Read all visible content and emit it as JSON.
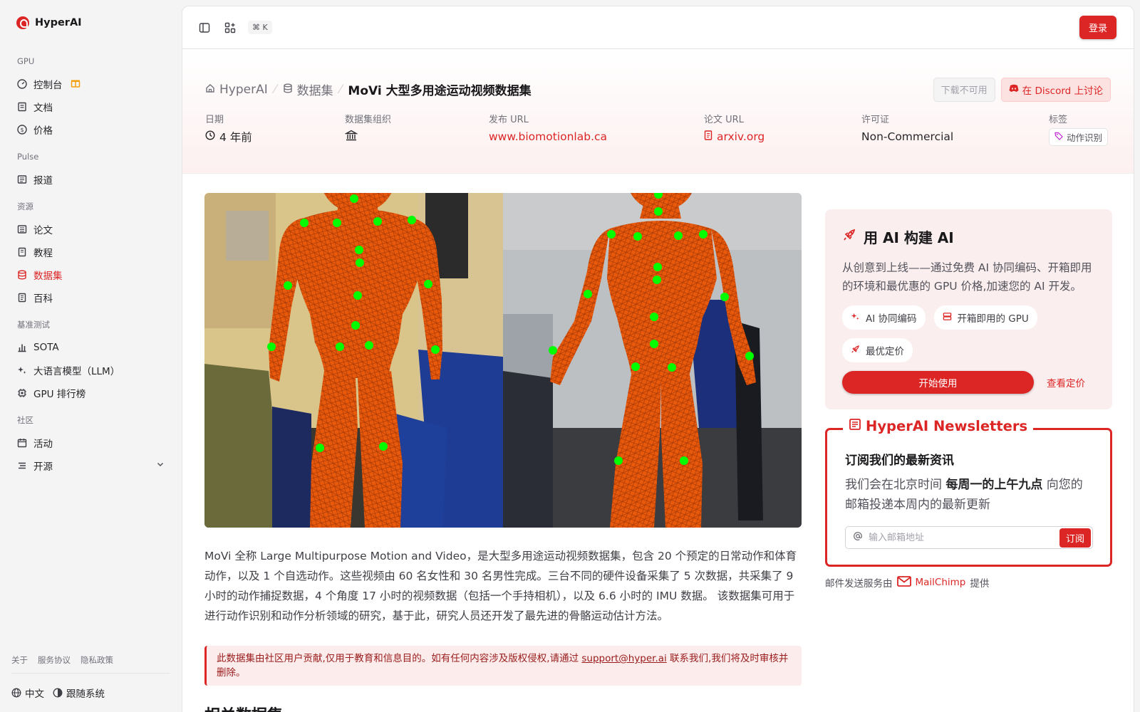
{
  "brand": {
    "name": "HyperAI"
  },
  "sidebar": {
    "sections": [
      {
        "title": "GPU",
        "items": [
          {
            "label": "控制台",
            "icon": "dashboard-icon"
          },
          {
            "label": "文档",
            "icon": "book-icon"
          },
          {
            "label": "价格",
            "icon": "dollar-icon"
          }
        ]
      },
      {
        "title": "Pulse",
        "items": [
          {
            "label": "报道",
            "icon": "newspaper-icon"
          }
        ]
      },
      {
        "title": "资源",
        "items": [
          {
            "label": "论文",
            "icon": "paper-icon"
          },
          {
            "label": "教程",
            "icon": "tutorial-icon"
          },
          {
            "label": "数据集",
            "icon": "database-icon",
            "active": true
          },
          {
            "label": "百科",
            "icon": "encyclopedia-icon"
          }
        ]
      },
      {
        "title": "基准测试",
        "items": [
          {
            "label": "SOTA",
            "icon": "bar-chart-icon"
          },
          {
            "label": "大语言模型（LLM）",
            "icon": "sparkle-icon"
          },
          {
            "label": "GPU 排行榜",
            "icon": "chip-icon"
          }
        ]
      },
      {
        "title": "社区",
        "items": [
          {
            "label": "活动",
            "icon": "calendar-icon"
          },
          {
            "label": "开源",
            "icon": "list-icon"
          }
        ]
      }
    ],
    "footer_links": [
      "关于",
      "服务协议",
      "隐私政策"
    ],
    "language": "中文",
    "theme": "跟随系统"
  },
  "topbar": {
    "shortcut": "⌘ K",
    "login": "登录"
  },
  "hero": {
    "breadcrumb": {
      "home": "HyperAI",
      "section": "数据集",
      "current": "MoVi 大型多用途运动视频数据集"
    },
    "download_label": "下载不可用",
    "discord_label": "在 Discord 上讨论",
    "meta": {
      "date_label": "日期",
      "date_value": "4 年前",
      "org_label": "数据集组织",
      "url_label": "发布 URL",
      "url_value": "www.biomotionlab.ca",
      "paper_label": "论文 URL",
      "paper_value": "arxiv.org",
      "license_label": "许可证",
      "license_value": "Non-Commercial",
      "tags_label": "标签",
      "tag_value": "动作识别"
    }
  },
  "content": {
    "description": "MoVi 全称 Large Multipurpose Motion and Video，是大型多用途运动视频数据集，包含 20 个预定的日常动作和体育动作，以及 1 个自选动作。这些视频由 60 名女性和 30 名男性完成。三台不同的硬件设备采集了 5 次数据，共采集了 9 小时的动作捕捉数据，4 个角度 17 小时的视频数据（包括一个手持相机），以及 6.6 小时的 IMU 数据。 该数据集可用于进行动作识别和动作分析领域的研究，基于此，研究人员还开发了最先进的骨骼运动估计方法。",
    "notice_prefix": "此数据集由社区用户贡献,仅用于教育和信息目的。如有任何内容涉及版权侵权,请通过 ",
    "notice_email": "support@hyper.ai",
    "notice_suffix": " 联系我们,我们将及时审核并删除。",
    "related_heading": "相关数据集"
  },
  "promo": {
    "title": "用 AI 构建 AI",
    "description": "从创意到上线——通过免费 AI 协同编码、开箱即用的环境和最优惠的 GPU 价格,加速您的 AI 开发。",
    "chips": [
      "AI 协同编码",
      "开箱即用的 GPU",
      "最优定价"
    ],
    "start_label": "开始使用",
    "pricing_label": "查看定价"
  },
  "newsletter": {
    "title": "HyperAI Newsletters",
    "heading": "订阅我们的最新资讯",
    "desc_prefix": "我们会在北京时间 ",
    "desc_bold": "每周一的上午九点",
    "desc_suffix": " 向您的邮箱投递本周内的最新更新",
    "placeholder": "输入邮箱地址",
    "subscribe_label": "订阅",
    "credit_prefix": "邮件发送服务由",
    "credit_service": "MailChimp",
    "credit_suffix": "提供"
  },
  "colors": {
    "accent": "#dc2626",
    "mesh": "#e8590c",
    "marker": "#00ff00"
  }
}
